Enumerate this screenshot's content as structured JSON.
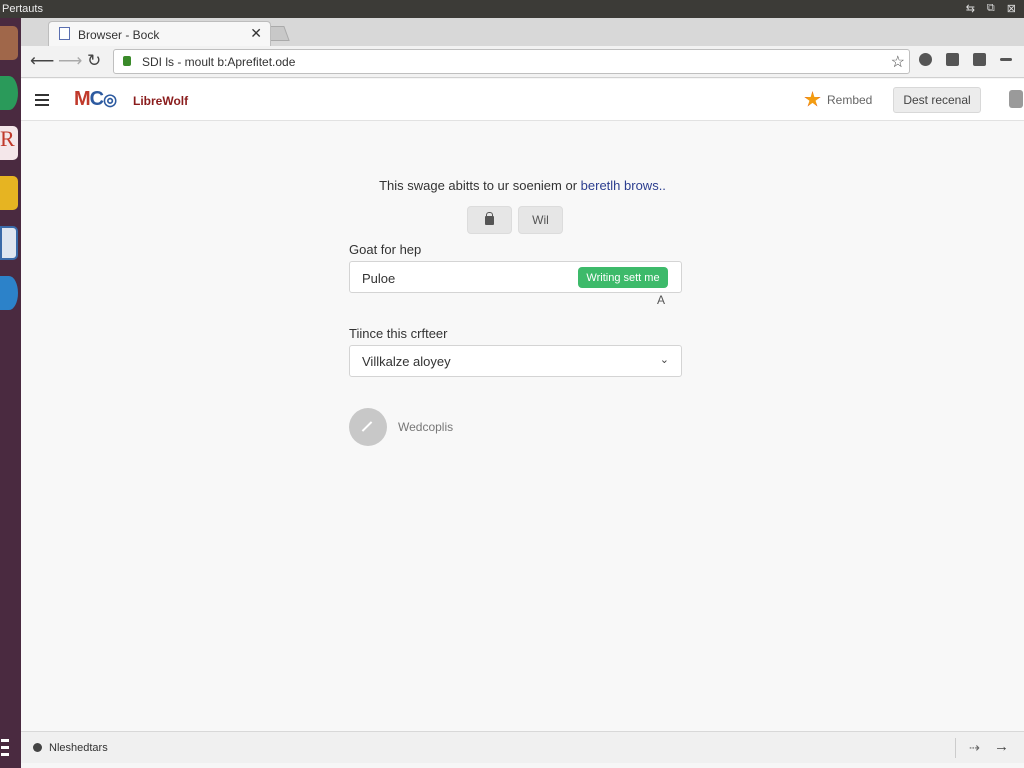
{
  "system": {
    "title": "Pertauts",
    "icons": [
      "arrow-icon",
      "window-icon",
      "close-icon"
    ]
  },
  "launcher": {
    "apps": [
      {
        "name": "photo-app-icon",
        "color": "#a0674a"
      },
      {
        "name": "browser-app-icon",
        "color": "#2a9a5a"
      },
      {
        "name": "r-app-icon",
        "color": "#c0392b"
      },
      {
        "name": "notes-app-icon",
        "color": "#e6b422"
      },
      {
        "name": "document-app-icon",
        "color": "#3a6aa8"
      },
      {
        "name": "globe-app-icon",
        "color": "#2c82c9"
      }
    ]
  },
  "browser": {
    "tab": {
      "title": "Browser - Bock",
      "close_glyph": "✕"
    },
    "url": "SDI ls - moult b:Aprefitet.ode",
    "star_glyph": "☆"
  },
  "site": {
    "logo_mark_m": "M",
    "logo_mark_c": "C",
    "logo_text": "LibreWolf",
    "remind_label": "Rembed",
    "dest_button": "Dest recenal"
  },
  "content": {
    "intro_text": "This swage abitts to ur soeniem or ",
    "intro_link": "beretlh brows..",
    "pill_2": "Wil",
    "field1": {
      "label": "Goat for hep",
      "value": "Puloe",
      "button": "Writing sett me"
    },
    "tiny_a": "A",
    "field2": {
      "label": "Tiince this crfteer",
      "value": "Villkalze aloyey",
      "chevron": "⌄"
    },
    "circle_label": "Wedcoplis"
  },
  "statusbar": {
    "text": "Nleshedtars"
  },
  "colors": {
    "accent_green": "#3dba6a",
    "link_blue": "#2c3e8f",
    "logo_red": "#8a1c1c"
  }
}
